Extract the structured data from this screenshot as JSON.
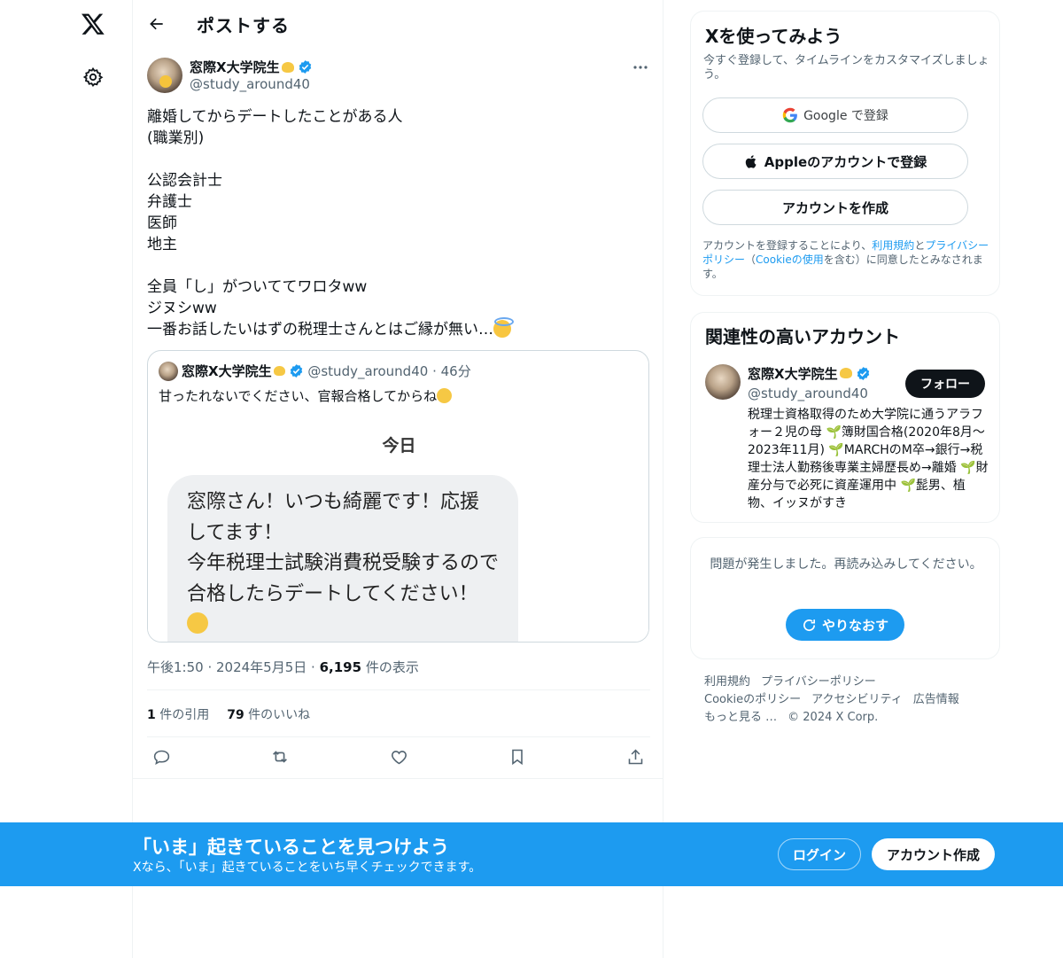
{
  "colors": {
    "accent": "#1d9bf0",
    "text": "#0f1419",
    "muted": "#536471",
    "border": "#cfd9de"
  },
  "header": {
    "title": "ポストする"
  },
  "post": {
    "author_name": "窓際X大学院生",
    "author_handle": "@study_around40",
    "text": "離婚してからデートしたことがある人\n(職業別)\n\n公認会計士\n弁護士\n医師\n地主\n\n全員「し」がついててワロタww\nジヌシww\n一番お話したいはずの税理士さんとはご縁が無い…",
    "time": "午後1:50",
    "date": "2024年5月5日",
    "views_count": "6,195",
    "views_label": "件の表示",
    "quotes_count": "1",
    "quotes_label": "件の引用",
    "likes_count": "79",
    "likes_label": "件のいいね"
  },
  "quote": {
    "author_name": "窓際X大学院生",
    "author_handle": "@study_around40",
    "time": "46分",
    "text": "甘ったれないでください、官報合格してからね",
    "image_heading": "今日",
    "image_message": "窓際さん！いつも綺麗です！応援してます！\n今年税理士試験消費税受験するので合格したらデートしてください！"
  },
  "signup": {
    "title": "Xを使ってみよう",
    "subtitle": "今すぐ登録して、タイムラインをカスタマイズしましょう。",
    "google_label": "Google で登録",
    "apple_label": "Appleのアカウントで登録",
    "create_label": "アカウントを作成",
    "legal_1": "アカウントを登録することにより、",
    "legal_terms": "利用規約",
    "legal_2": "と",
    "legal_privacy": "プライバシーポリシー",
    "legal_3": "（",
    "legal_cookie": "Cookieの使用",
    "legal_4": "を含む）に同意したとみなされます。"
  },
  "related": {
    "title": "関連性の高いアカウント",
    "name": "窓際X大学院生",
    "handle": "@study_around40",
    "follow_label": "フォロー",
    "bio": "税理士資格取得のため大学院に通うアラフォー２児の母 🌱簿財国合格(2020年8月〜2023年11月) 🌱MARCHのM卒→銀行→税理士法人勤務後専業主婦歴長め→離婚 🌱財産分与で必死に資産運用中 🌱髭男、植物、イッヌがすき"
  },
  "error": {
    "text": "問題が発生しました。再読み込みしてください。",
    "retry_label": "やりなおす"
  },
  "footer": {
    "links": [
      "利用規約",
      "プライバシーポリシー",
      "Cookieのポリシー",
      "アクセシビリティ",
      "広告情報",
      "もっと見る …"
    ],
    "copyright": "© 2024 X Corp."
  },
  "banner": {
    "title": "「いま」起きていることを見つけよう",
    "subtitle": "Xなら、「いま」起きていることをいち早くチェックできます。",
    "login_label": "ログイン",
    "signup_label": "アカウント作成"
  }
}
